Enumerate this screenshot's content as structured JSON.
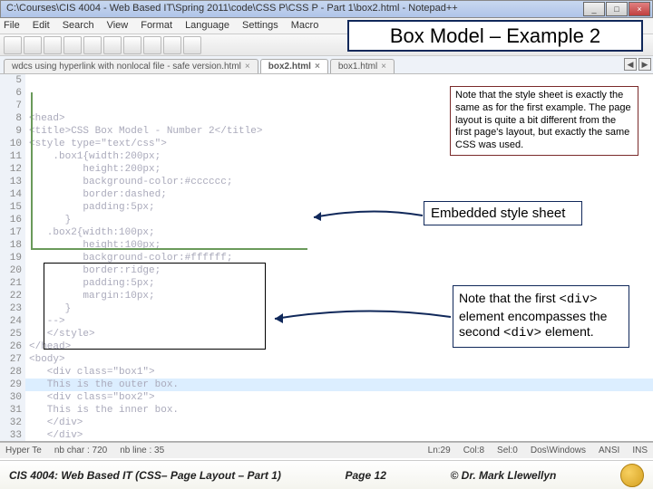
{
  "window": {
    "title": "C:\\Courses\\CIS 4004 - Web Based IT\\Spring 2011\\code\\CSS P\\CSS P - Part 1\\box2.html - Notepad++"
  },
  "winbtns": {
    "min": "_",
    "max": "□",
    "close": "×"
  },
  "menu": {
    "file": "File",
    "edit": "Edit",
    "search": "Search",
    "view": "View",
    "format": "Format",
    "language": "Language",
    "settings": "Settings",
    "macro": "Macro"
  },
  "tabs": {
    "t1": "wdcs using hyperlink with nonlocal file - safe version.html",
    "t2": "box2.html",
    "t3": "box1.html"
  },
  "navbtns": {
    "left": "◀",
    "right": "▶"
  },
  "gutter_start": 5,
  "lines": [
    "<head>",
    "<title>CSS Box Model - Number 2</title>",
    "<style type=\"text/css\">",
    "",
    "    .box1{width:200px;",
    "         height:200px;",
    "         background-color:#cccccc;",
    "         border:dashed;",
    "         padding:5px;",
    "      }",
    "   .box2{width:100px;",
    "         height:100px;",
    "         background-color:#ffffff;",
    "         border:ridge;",
    "         padding:5px;",
    "         margin:10px;",
    "      }",
    "   -->",
    "   </style>",
    "</head>",
    "<body>",
    "   <div class=\"box1\">",
    "   This is the outer box.",
    "   <div class=\"box2\">",
    "   This is the inner box.",
    "   </div>",
    "   </div>",
    "",
    ""
  ],
  "status": {
    "s1": "Hyper Te",
    "s2": "nb char : 720",
    "s3": "nb line : 35",
    "s4": "Ln:29",
    "s5": "Col:8",
    "s6": "Sel:0",
    "s7": "Dos\\Windows",
    "s8": "ANSI",
    "s9": "INS"
  },
  "slide_title": "Box Model – Example 2",
  "note1": "Note that the style sheet is exactly the same as for the first example.  The page layout is quite a bit different from the first page's layout, but exactly the same CSS was used.",
  "note2": "Embedded style sheet",
  "note3_a": "Note that the first ",
  "note3_b": "<div>",
  "note3_c": " element encompasses the second ",
  "note3_d": "<div>",
  "note3_e": " element.",
  "footer": {
    "left": "CIS 4004: Web Based IT (CSS– Page Layout – Part 1)",
    "mid": "Page 12",
    "right": "© Dr. Mark Llewellyn"
  },
  "foldmark": "-"
}
